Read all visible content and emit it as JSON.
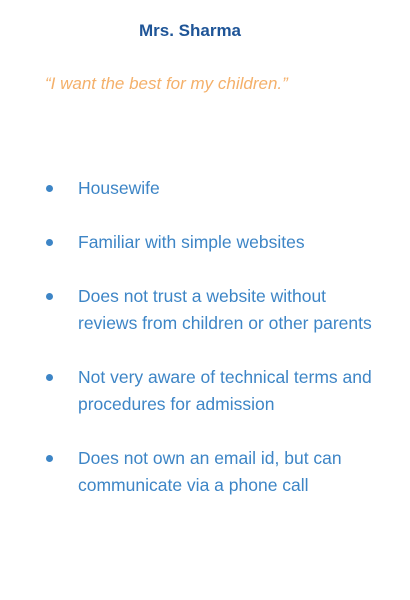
{
  "persona": {
    "name": "Mrs. Sharma",
    "quote": "“I want the best for my children.”",
    "traits": [
      "Housewife",
      "Familiar with simple websites",
      "Does not trust a website without reviews from children or other parents",
      "Not very aware of technical terms and procedures for admission",
      "Does not own an email id, but can communicate via a phone call"
    ]
  },
  "colors": {
    "name": "#1f5597",
    "quote": "#f4b06a",
    "traits": "#3d85c6",
    "background": "#ffffff"
  }
}
